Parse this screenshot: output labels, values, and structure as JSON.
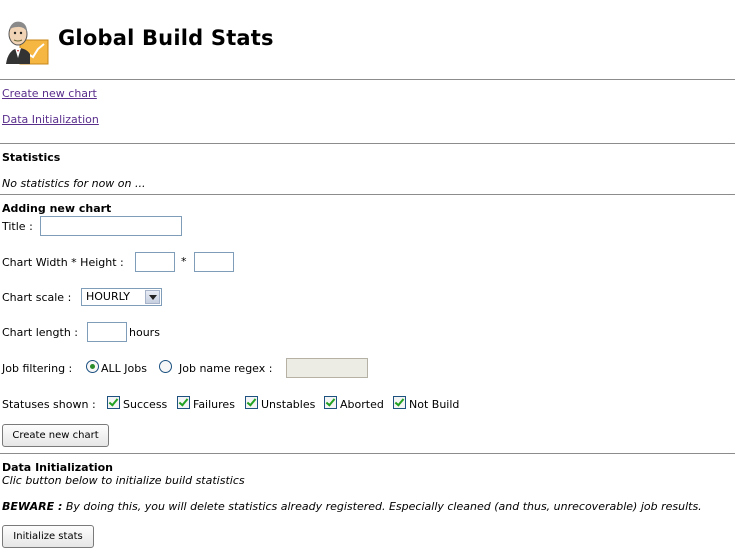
{
  "header": {
    "title": "Global Build Stats"
  },
  "links": {
    "create_new_chart": "Create new chart",
    "data_initialization": "Data Initialization"
  },
  "statistics": {
    "heading": "Statistics",
    "empty_text": "No statistics for now on ..."
  },
  "add_chart": {
    "heading": "Adding new chart",
    "title_label": "Title :",
    "title_value": "",
    "size_label": "Chart Width * Height :",
    "size_separator": "*",
    "width_value": "",
    "height_value": "",
    "scale_label": "Chart scale :",
    "scale_selected": "HOURLY",
    "length_label": "Chart length :",
    "length_value": "",
    "length_unit": "hours",
    "filter_label": "Job filtering :",
    "filter_all": "ALL Jobs",
    "filter_regex": "Job name regex :",
    "regex_value": "",
    "statuses_label": "Statuses shown :",
    "statuses": {
      "success": "Success",
      "failures": "Failures",
      "unstables": "Unstables",
      "aborted": "Aborted",
      "not_build": "Not Build"
    },
    "submit_label": "Create new chart"
  },
  "data_init": {
    "heading": "Data Initialization",
    "description": "Clic button below to initialize build statistics",
    "beware_label": "BEWARE :",
    "beware_text": "By doing this, you will delete statistics already registered. Especially cleaned (and thus, unrecoverable) job results.",
    "button_label": "Initialize stats"
  },
  "colors": {
    "link": "#5a2f8c",
    "divider": "#8c8c8c",
    "logo_accent": "#f5b642"
  },
  "icons": {
    "logo": "butler-with-chart-icon"
  }
}
